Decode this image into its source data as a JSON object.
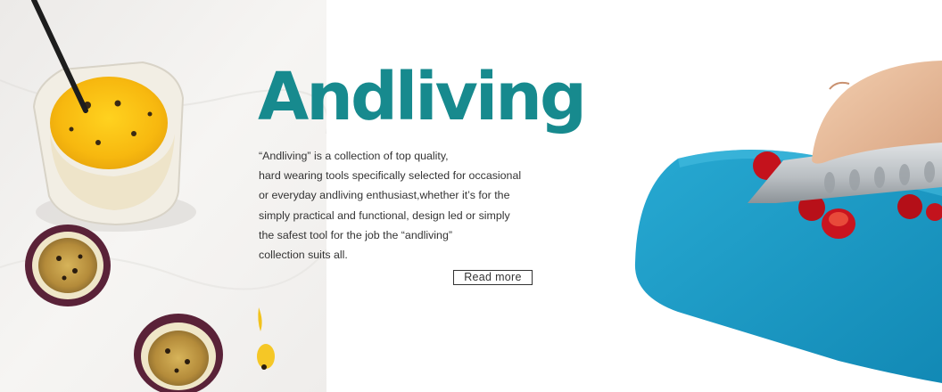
{
  "banner": {
    "brand": "Andliving",
    "description_lines": [
      "“Andliving” is a collection of top quality,",
      "hard wearing tools specifically selected for occasional",
      "or everyday andliving enthusiast,whether it’s for the",
      "simply practical and functional, design led or simply",
      "the safest tool for the job the “andliving”",
      "collection suits all."
    ],
    "read_more_label": "Read  more"
  },
  "colors": {
    "brand_teal": "#178a8e",
    "board_blue": "#1d9bc4",
    "text": "#333333"
  },
  "icons": {
    "left_image": "passion-fruit-drink-photo",
    "right_image": "knife-cutting-board-photo"
  }
}
